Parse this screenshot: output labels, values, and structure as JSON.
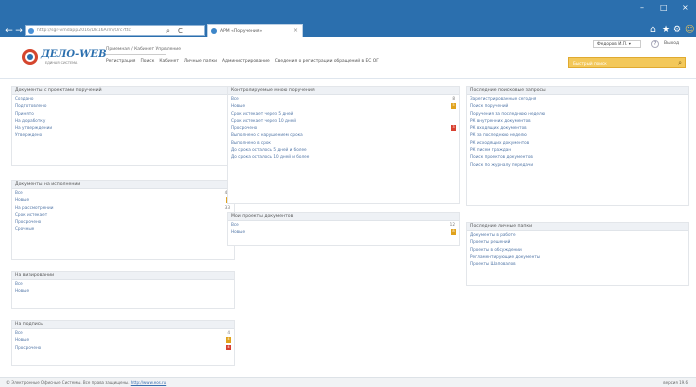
{
  "browser": {
    "url": "http://sgr-vmdapp2016/Dk16Arm/Orc?ttc",
    "tab_title": "АРМ «Поручения»",
    "back": "←",
    "forward": "→",
    "reload": "C",
    "search_glyph": "⌕",
    "tab_close": "×",
    "win_min": "–",
    "win_max": "□",
    "win_close": "×",
    "home_glyph": "⌂",
    "star_glyph": "★",
    "gear_glyph": "⚙",
    "smile_glyph": "☺"
  },
  "app": {
    "logo": "ДЕЛО-WEB",
    "logo_sub": "ЕДИНАЯ СИСТЕМА",
    "workplace": "Приемная / Кабинет Упрвление",
    "user": "Федоров И.П.",
    "help": "?",
    "logout": "Выход",
    "menu": [
      "Регистрация",
      "Поиск",
      "Кабинет",
      "Личные папки",
      "Администрирование",
      "Сведения о регистрации обращений в ЕС ОГ"
    ],
    "quick_search_placeholder": "Быстрый поиск",
    "search_icon": "search-icon"
  },
  "panels": {
    "docs_review": {
      "title": "Документы с проектами поручений",
      "rows": [
        {
          "label": "Создано"
        },
        {
          "label": "Подготовлено"
        },
        {
          "label": "Принято"
        },
        {
          "label": "На доработку"
        },
        {
          "label": "На утверждении"
        },
        {
          "label": "Утверждено"
        }
      ]
    },
    "docs_exec": {
      "title": "Документы на исполнении",
      "rows": [
        {
          "label": "Все",
          "count": "44"
        },
        {
          "label": "Новые",
          "count": "11",
          "badge": "orange"
        },
        {
          "label": "На рассмотрении",
          "count": "33"
        },
        {
          "label": "Срок истекает"
        },
        {
          "label": "Просрочено"
        },
        {
          "label": "Срочные"
        }
      ]
    },
    "approval": {
      "title": "На визировании",
      "rows": [
        {
          "label": "Все"
        },
        {
          "label": "Новые"
        }
      ]
    },
    "signing": {
      "title": "На подпись",
      "rows": [
        {
          "label": "Все",
          "count": "4"
        },
        {
          "label": "Новые",
          "count": "4",
          "badge": "orange"
        },
        {
          "label": "Просрочено",
          "count": "4",
          "badge": "red"
        }
      ]
    },
    "controlled": {
      "title": "Контролируемые мною поручения",
      "rows": [
        {
          "label": "Все",
          "count": "8"
        },
        {
          "label": "Новые",
          "count": "5",
          "badge": "orange"
        },
        {
          "label": "Срок истекает через 5 дней"
        },
        {
          "label": "Срок истекает через 10 дней"
        },
        {
          "label": "Просрочено",
          "count": "3",
          "badge": "red"
        },
        {
          "label": "Выполнено с нарушением срока"
        },
        {
          "label": "Выполнено в срок"
        },
        {
          "label": "До срока осталось 5 дней и более"
        },
        {
          "label": "До срока осталось 10 дней и более"
        }
      ]
    },
    "projects": {
      "title": "Мои проекты документов",
      "rows": [
        {
          "label": "Все",
          "count": "12"
        },
        {
          "label": "Новые",
          "count": "8",
          "badge": "orange"
        }
      ]
    },
    "recent_search": {
      "title": "Последние поисковые запросы",
      "rows": [
        {
          "label": "Зарегистрированные сегодня"
        },
        {
          "label": "Поиск поручений"
        },
        {
          "label": "Поручения за последнюю неделю"
        },
        {
          "label": "РК внутренних документов"
        },
        {
          "label": "РК входящих документов"
        },
        {
          "label": "РК за последнюю неделю"
        },
        {
          "label": "РК исходящих документов"
        },
        {
          "label": "РК писем граждан"
        },
        {
          "label": "Поиск проектов документов"
        },
        {
          "label": "Поиск по журналу передачи"
        }
      ]
    },
    "personal_folders": {
      "title": "Последние личные папки",
      "rows": [
        {
          "label": "Документы в работе"
        },
        {
          "label": "Проекты решений"
        },
        {
          "label": "Проекты в обсуждении"
        },
        {
          "label": "Регламентирующие документы"
        },
        {
          "label": "Проекты Шаповалов"
        }
      ]
    }
  },
  "footer": {
    "text": "© Электронные Офисные Системы. Все права защищены.",
    "link": "http://www.eos.ru",
    "version": "версия 19.6"
  },
  "colors": {
    "chrome": "#2b6fae",
    "accent": "#f3c85a",
    "badge_orange": "#e0a21c",
    "badge_red": "#d84030",
    "link": "#5075a6"
  }
}
